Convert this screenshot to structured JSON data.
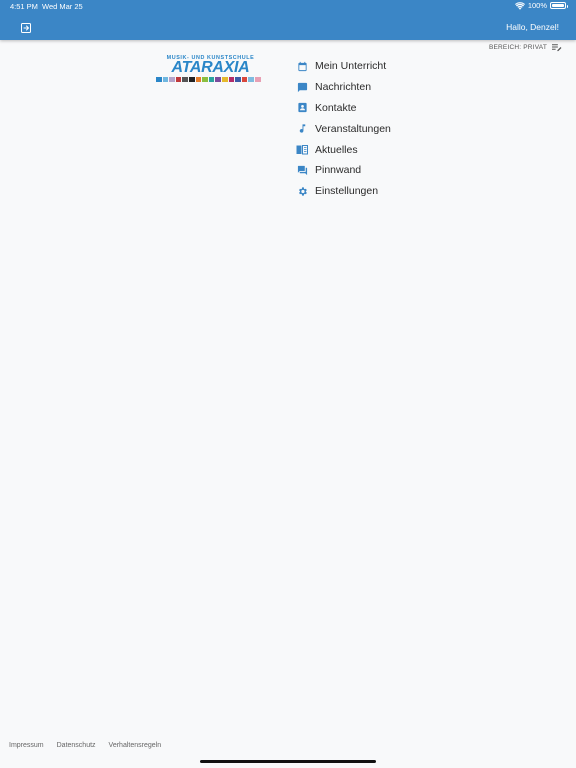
{
  "status_bar": {
    "time": "4:51 PM",
    "date": "Wed Mar 25",
    "battery": "100%",
    "battery_level": 1.0,
    "wifi_icon": "wifi-icon"
  },
  "header": {
    "greeting": "Hallo, Denzel!",
    "background": "#3b86c6",
    "logout_icon": "logout-icon"
  },
  "area": {
    "label": "BEREICH: PRIVAT",
    "icon": "playlist-edit-icon"
  },
  "logo": {
    "top_text": "MUSIK- UND KUNSTSCHULE",
    "name": "ATARAXIA",
    "color": "#2a86c8"
  },
  "menu": {
    "icon_color": "#3b86c6",
    "items": [
      {
        "label": "Mein Unterricht",
        "icon": "calendar-icon"
      },
      {
        "label": "Nachrichten",
        "icon": "chat-icon"
      },
      {
        "label": "Kontakte",
        "icon": "contact-icon"
      },
      {
        "label": "Veranstaltungen",
        "icon": "music-note-icon"
      },
      {
        "label": "Aktuelles",
        "icon": "book-icon"
      },
      {
        "label": "Pinnwand",
        "icon": "forum-icon"
      },
      {
        "label": "Einstellungen",
        "icon": "gear-icon"
      }
    ]
  },
  "footer": {
    "links": [
      "Impressum",
      "Datenschutz",
      "Verhaltensregeln"
    ]
  }
}
